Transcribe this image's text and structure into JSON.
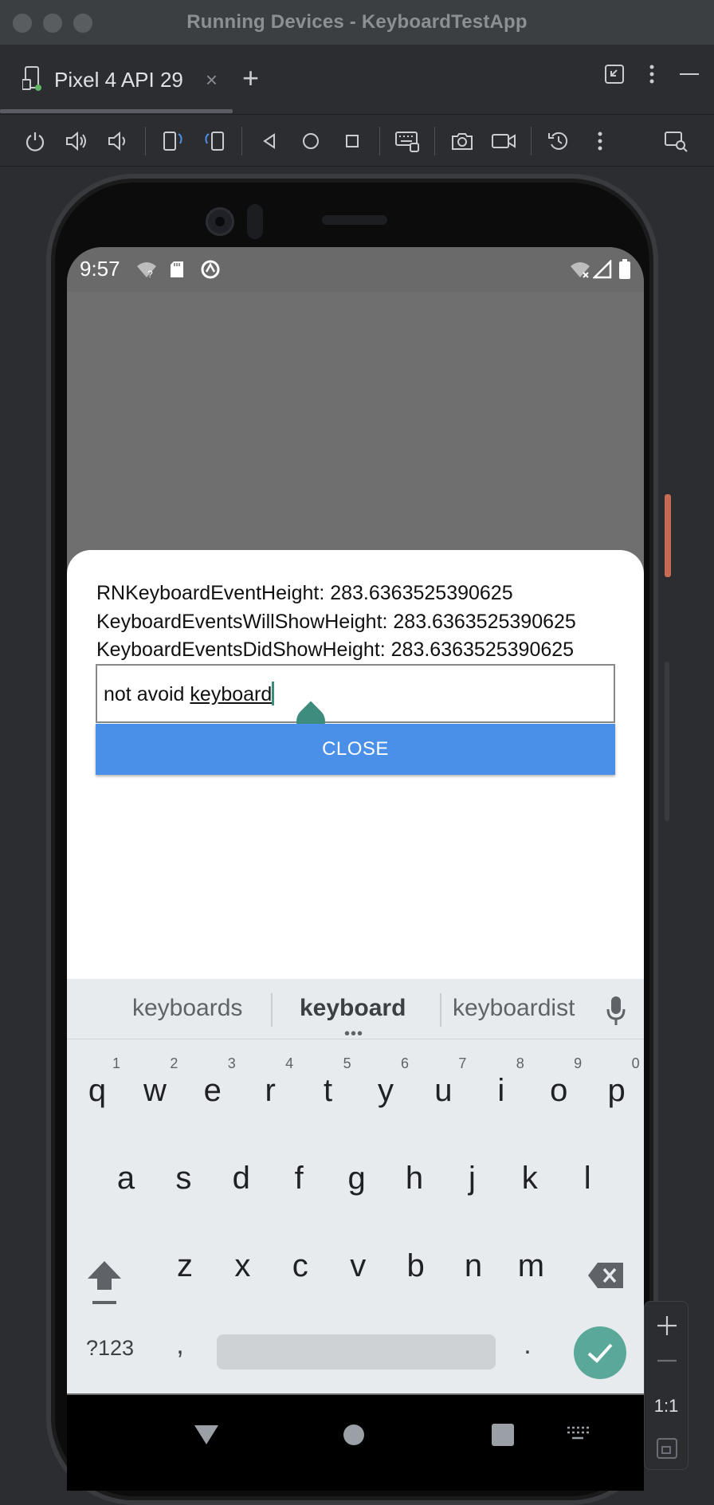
{
  "window": {
    "title": "Running Devices - KeyboardTestApp"
  },
  "tabs": [
    {
      "label": "Pixel 4 API 29"
    }
  ],
  "device": {
    "status_time": "9:57",
    "info": {
      "line1": "RNKeyboardEventHeight: 283.6363525390625",
      "line2": "KeyboardEventsWillShowHeight: 283.6363525390625",
      "line3": "KeyboardEventsDidShowHeight: 283.6363525390625"
    },
    "input": {
      "value_plain": "not avoid ",
      "value_composing": "keyboard"
    },
    "close_label": "CLOSE",
    "suggestions": [
      "keyboards",
      "keyboard",
      "keyboardist"
    ],
    "keyboard": {
      "row1": [
        "q",
        "w",
        "e",
        "r",
        "t",
        "y",
        "u",
        "i",
        "o",
        "p"
      ],
      "row1_hints": [
        "1",
        "2",
        "3",
        "4",
        "5",
        "6",
        "7",
        "8",
        "9",
        "0"
      ],
      "row2": [
        "a",
        "s",
        "d",
        "f",
        "g",
        "h",
        "j",
        "k",
        "l"
      ],
      "row3": [
        "z",
        "x",
        "c",
        "v",
        "b",
        "n",
        "m"
      ],
      "symbols_label": "?123",
      "comma": ",",
      "period": "."
    }
  },
  "zoom": {
    "ratio_label": "1:1"
  },
  "colors": {
    "accent": "#4a90e8",
    "teal": "#3d8c7e"
  }
}
